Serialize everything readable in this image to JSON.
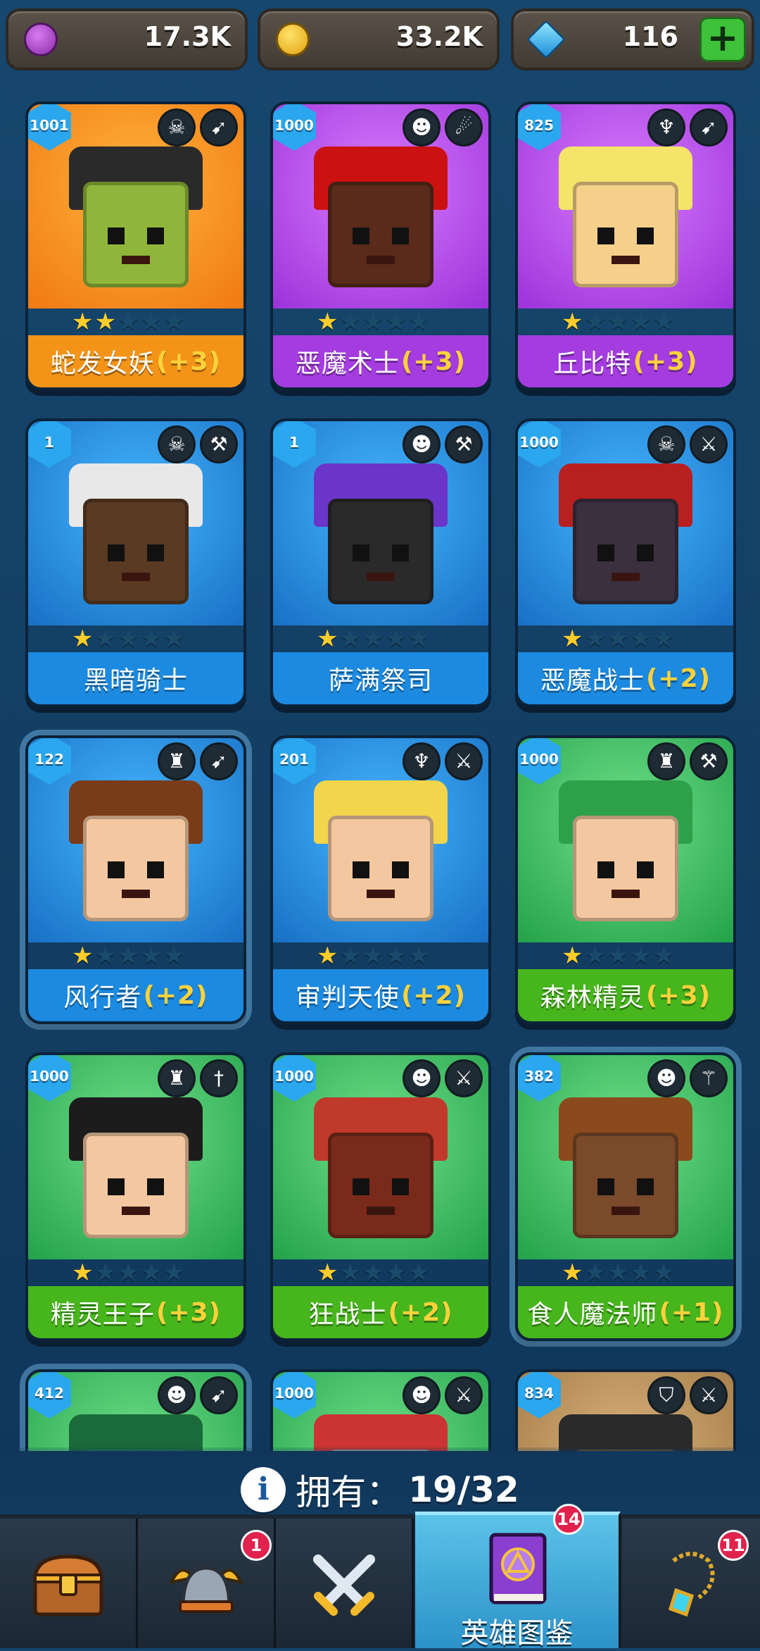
{
  "currencies": [
    {
      "icon": "purple-gem-coin-icon",
      "value": "17.3K"
    },
    {
      "icon": "gold-coin-icon",
      "value": "33.2K"
    },
    {
      "icon": "blue-diamond-icon",
      "value": "116",
      "add_label": "+"
    }
  ],
  "heroes": [
    {
      "name": "蛇发女妖",
      "bonus": "(+3)",
      "level": "1001",
      "stars": 2,
      "theme": "orange",
      "faction_icon": "skull-icon",
      "weapon_icon": "bow-icon"
    },
    {
      "name": "恶魔术士",
      "bonus": "(+3)",
      "level": "1000",
      "stars": 1,
      "theme": "purple",
      "faction_icon": "ogre-icon",
      "weapon_icon": "fireball-icon"
    },
    {
      "name": "丘比特",
      "bonus": "(+3)",
      "level": "825",
      "stars": 1,
      "theme": "purple",
      "faction_icon": "wings-icon",
      "weapon_icon": "bow-icon"
    },
    {
      "name": "黑暗骑士",
      "bonus": "",
      "level": "1",
      "stars": 1,
      "theme": "blue",
      "faction_icon": "skull-icon",
      "weapon_icon": "hammer-icon"
    },
    {
      "name": "萨满祭司",
      "bonus": "",
      "level": "1",
      "stars": 1,
      "theme": "blue",
      "faction_icon": "ogre-icon",
      "weapon_icon": "hammer-icon"
    },
    {
      "name": "恶魔战士",
      "bonus": "(+2)",
      "level": "1000",
      "stars": 1,
      "theme": "blue",
      "faction_icon": "skull-icon",
      "weapon_icon": "sword-icon"
    },
    {
      "name": "风行者",
      "bonus": "(+2)",
      "level": "122",
      "stars": 1,
      "theme": "blue",
      "faction_icon": "elf-icon",
      "weapon_icon": "bow-icon"
    },
    {
      "name": "审判天使",
      "bonus": "(+2)",
      "level": "201",
      "stars": 1,
      "theme": "blue",
      "faction_icon": "wings-icon",
      "weapon_icon": "sword-icon"
    },
    {
      "name": "森林精灵",
      "bonus": "(+3)",
      "level": "1000",
      "stars": 1,
      "theme": "green",
      "faction_icon": "elf-icon",
      "weapon_icon": "hammer-icon"
    },
    {
      "name": "精灵王子",
      "bonus": "(+3)",
      "level": "1000",
      "stars": 1,
      "theme": "green",
      "faction_icon": "elf-icon",
      "weapon_icon": "dagger-icon"
    },
    {
      "name": "狂战士",
      "bonus": "(+2)",
      "level": "1000",
      "stars": 1,
      "theme": "green",
      "faction_icon": "ogre-icon",
      "weapon_icon": "sword-icon"
    },
    {
      "name": "食人魔法师",
      "bonus": "(+1)",
      "level": "382",
      "stars": 1,
      "theme": "green",
      "faction_icon": "ogre-icon",
      "weapon_icon": "staff-icon"
    },
    {
      "name": "",
      "bonus": "",
      "level": "412",
      "stars": 0,
      "theme": "green",
      "faction_icon": "ogre-icon",
      "weapon_icon": "bow-icon"
    },
    {
      "name": "",
      "bonus": "",
      "level": "1000",
      "stars": 0,
      "theme": "green",
      "faction_icon": "ogre-icon",
      "weapon_icon": "sword-icon"
    },
    {
      "name": "",
      "bonus": "",
      "level": "834",
      "stars": 0,
      "theme": "brown",
      "faction_icon": "helmet-icon",
      "weapon_icon": "sword-icon"
    }
  ],
  "owned": {
    "label": "拥有：",
    "count": "19/32"
  },
  "nav": {
    "tabs": [
      {
        "icon": "treasure-chest-icon",
        "label": "",
        "badge": ""
      },
      {
        "icon": "viking-helmet-icon",
        "label": "",
        "badge": "1"
      },
      {
        "icon": "crossed-swords-icon",
        "label": "",
        "badge": ""
      },
      {
        "icon": "hero-book-icon",
        "label": "英雄图鉴",
        "badge": "14"
      },
      {
        "icon": "amulet-icon",
        "label": "",
        "badge": "11"
      }
    ]
  }
}
